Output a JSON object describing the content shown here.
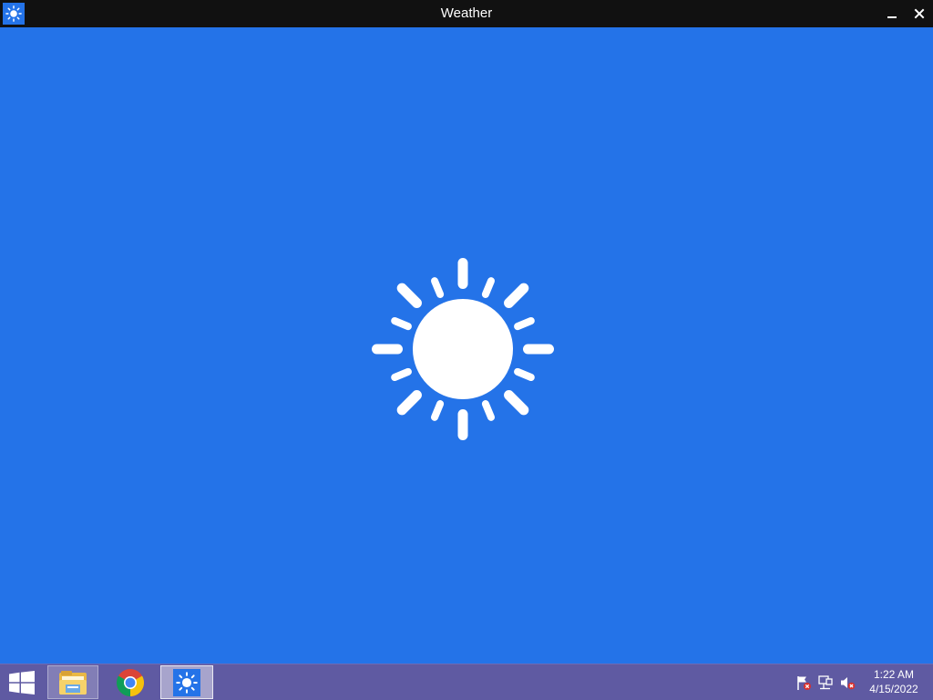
{
  "window": {
    "title": "Weather",
    "icon": "sun-icon",
    "controls": [
      "minimize-icon",
      "close-icon"
    ]
  },
  "splash": {
    "icon": "sun-icon"
  },
  "taskbar": {
    "start": "windows-logo-icon",
    "apps": [
      {
        "name": "File Explorer",
        "icon": "folder-icon",
        "state": "open"
      },
      {
        "name": "Google Chrome",
        "icon": "chrome-icon",
        "state": "pinned"
      },
      {
        "name": "Weather",
        "icon": "sun-icon",
        "state": "active"
      }
    ],
    "tray": {
      "icons": [
        "action-center-flag-icon",
        "network-icon",
        "volume-muted-icon"
      ]
    },
    "clock": {
      "time": "1:22 AM",
      "date": "4/15/2022"
    }
  },
  "colors": {
    "app_background": "#2473e8",
    "titlebar": "#111111",
    "taskbar": "#5f5aa2",
    "foreground": "#ffffff"
  }
}
